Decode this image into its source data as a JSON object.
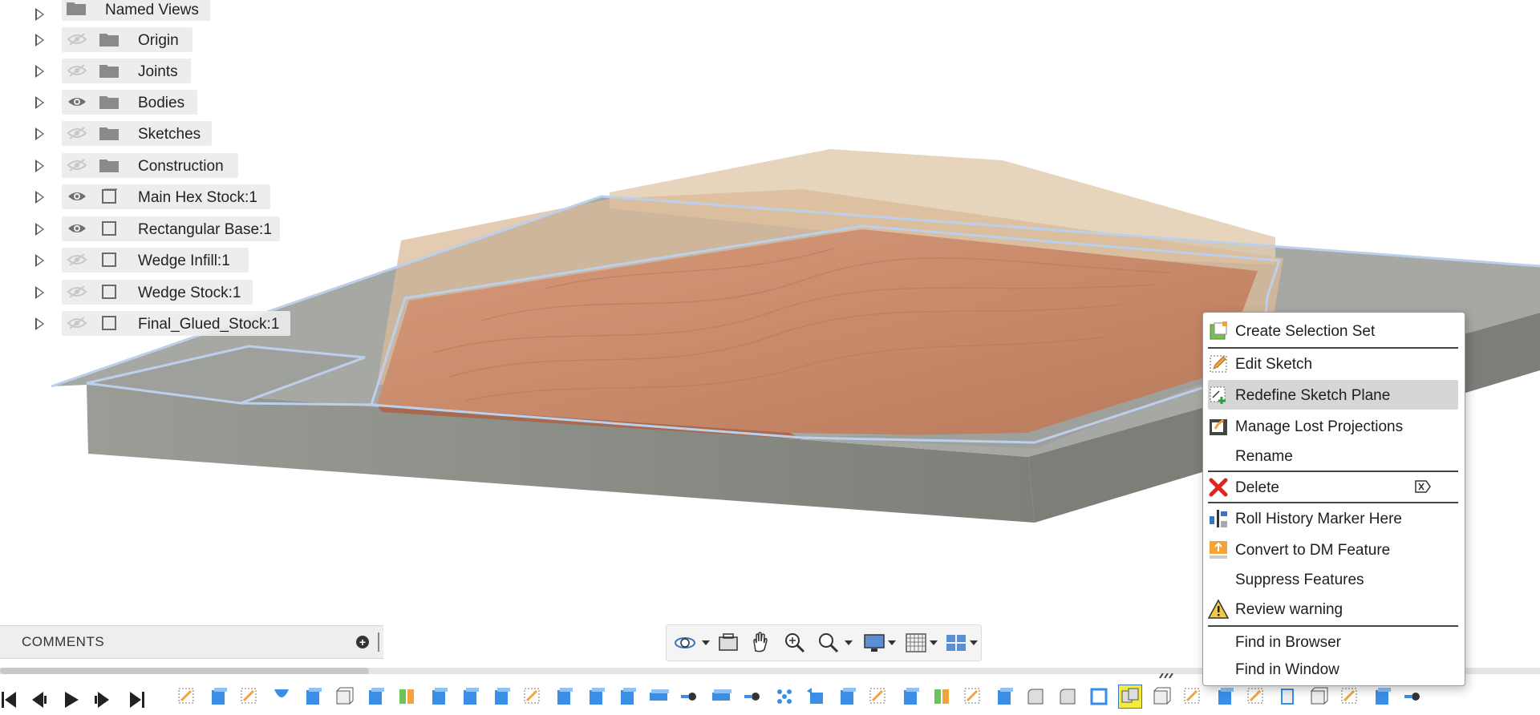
{
  "browser": {
    "items": [
      {
        "label": "Named Views",
        "visibility": "none",
        "icon": "folder-icon"
      },
      {
        "label": "Origin",
        "visibility": "hidden",
        "icon": "folder-icon"
      },
      {
        "label": "Joints",
        "visibility": "hidden",
        "icon": "folder-icon"
      },
      {
        "label": "Bodies",
        "visibility": "visible",
        "icon": "folder-icon"
      },
      {
        "label": "Sketches",
        "visibility": "hidden",
        "icon": "folder-icon"
      },
      {
        "label": "Construction",
        "visibility": "hidden",
        "icon": "folder-icon"
      },
      {
        "label": "Main Hex Stock:1",
        "visibility": "visible",
        "icon": "component-icon"
      },
      {
        "label": "Rectangular Base:1",
        "visibility": "visible",
        "icon": "component-icon"
      },
      {
        "label": "Wedge Infill:1",
        "visibility": "hidden",
        "icon": "component-icon"
      },
      {
        "label": "Wedge Stock:1",
        "visibility": "hidden",
        "icon": "component-icon"
      },
      {
        "label": "Final_Glued_Stock:1",
        "visibility": "hidden",
        "icon": "component-icon"
      }
    ]
  },
  "comments": {
    "title": "COMMENTS"
  },
  "navbar": {
    "tools": [
      "orbit-icon",
      "look-at-icon",
      "pan-icon",
      "zoom-icon",
      "zoom-window-icon",
      "display-settings-icon",
      "grid-settings-icon",
      "viewports-icon"
    ]
  },
  "context_menu": {
    "items": [
      {
        "label": "Create Selection Set",
        "icon": "selection-set-icon"
      },
      {
        "label": "Edit Sketch",
        "icon": "edit-sketch-icon"
      },
      {
        "label": "Redefine Sketch Plane",
        "icon": "redefine-plane-icon",
        "highlighted": true
      },
      {
        "label": "Manage Lost Projections",
        "icon": "manage-projections-icon"
      },
      {
        "label": "Rename",
        "icon": ""
      },
      {
        "label": "Delete",
        "icon": "delete-icon",
        "shortcut": "delete-key-icon"
      },
      {
        "label": "Roll History Marker Here",
        "icon": "roll-marker-icon"
      },
      {
        "label": "Convert to DM Feature",
        "icon": "convert-dm-icon"
      },
      {
        "label": "Suppress Features",
        "icon": ""
      },
      {
        "label": "Review warning",
        "icon": "warning-icon"
      },
      {
        "label": "Find in Browser",
        "icon": ""
      },
      {
        "label": "Find in Window",
        "icon": ""
      }
    ]
  },
  "colors": {
    "wood": "#c98d6f",
    "wood_transparent": "#dcc4a8",
    "base_top": "#a6a9a3",
    "base_side": "#8f918b",
    "selection_outline": "#b8cdea",
    "menu_highlight": "#d6d6d6",
    "timeline_selected": "#f4ec38"
  }
}
